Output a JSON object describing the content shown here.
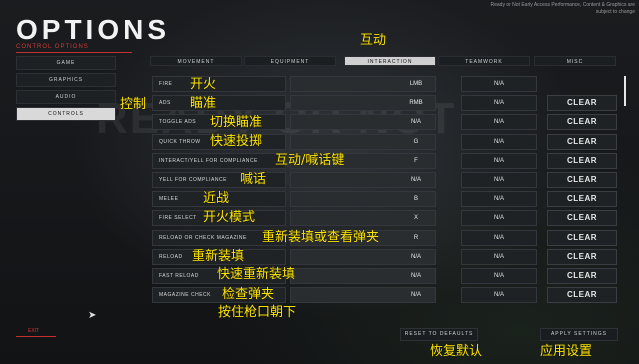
{
  "header": {
    "title": "OPTIONS",
    "subtitle": "CONTROL OPTIONS",
    "topright": "Ready or Not Early Access\nPerformance, Content & Graphics are subject to change"
  },
  "left_nav": {
    "items": [
      {
        "label": "GAME"
      },
      {
        "label": "GRAPHICS"
      },
      {
        "label": "AUDIO"
      },
      {
        "label": "CONTROLS",
        "active": true
      }
    ]
  },
  "tabs": [
    {
      "label": "MOVEMENT"
    },
    {
      "label": "EQUIPMENT"
    },
    {
      "label": "INTERACTION",
      "active": true
    },
    {
      "label": "TEAMWORK"
    },
    {
      "label": "MISC"
    }
  ],
  "bindings": [
    {
      "action": "FIRE",
      "key": "LMB",
      "alt": "N/A",
      "clear": ""
    },
    {
      "action": "ADS",
      "key": "RMB",
      "alt": "N/A",
      "clear": "CLEAR"
    },
    {
      "action": "TOGGLE ADS",
      "key": "N/A",
      "alt": "N/A",
      "clear": "CLEAR"
    },
    {
      "action": "QUICK THROW",
      "key": "G",
      "alt": "N/A",
      "clear": "CLEAR"
    },
    {
      "action": "INTERACT/YELL FOR COMPLIANCE",
      "key": "F",
      "alt": "N/A",
      "clear": "CLEAR"
    },
    {
      "action": "YELL FOR COMPLIANCE",
      "key": "N/A",
      "alt": "N/A",
      "clear": "CLEAR"
    },
    {
      "action": "MELEE",
      "key": "B",
      "alt": "N/A",
      "clear": "CLEAR"
    },
    {
      "action": "FIRE SELECT",
      "key": "X",
      "alt": "N/A",
      "clear": "CLEAR"
    },
    {
      "action": "RELOAD OR CHECK MAGAZINE",
      "key": "R",
      "alt": "N/A",
      "clear": "CLEAR"
    },
    {
      "action": "RELOAD",
      "key": "N/A",
      "alt": "N/A",
      "clear": "CLEAR"
    },
    {
      "action": "FAST RELOAD",
      "key": "N/A",
      "alt": "N/A",
      "clear": "CLEAR"
    },
    {
      "action": "MAGAZINE CHECK",
      "key": "N/A",
      "alt": "N/A",
      "clear": "CLEAR"
    }
  ],
  "bottom": {
    "exit": "EXIT",
    "reset": "RESET TO DEFAULTS",
    "apply": "APPLY SETTINGS"
  },
  "annotations": {
    "tab_interaction": "互动",
    "controls": "控制",
    "fire": "开火",
    "ads": "瞄准",
    "toggle_ads": "切换瞄准",
    "quick_throw": "快速投掷",
    "interact": "互动/喊话键",
    "yell": "喊话",
    "melee": "近战",
    "fire_select": "开火模式",
    "reload_or_check": "重新装填或查看弹夹",
    "reload": "重新装填",
    "fast_reload": "快速重新装填",
    "mag_check": "检查弹夹",
    "low_ready": "按住枪口朝下",
    "reset": "恢复默认",
    "apply": "应用设置"
  },
  "colors": {
    "accent_red": "#c43030",
    "annotation_yellow": "#ffe600"
  }
}
